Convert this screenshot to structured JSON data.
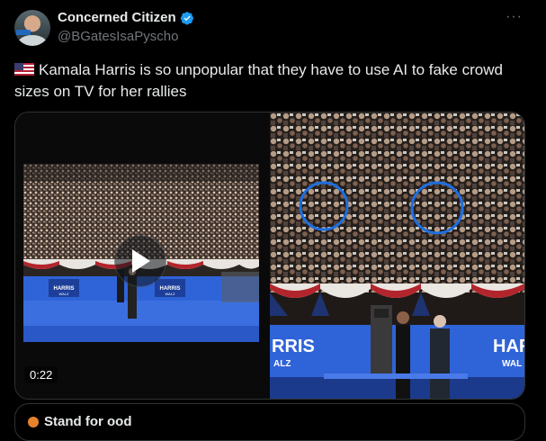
{
  "author": {
    "display_name": "Concerned Citizen",
    "handle": "@BGatesIsaPyscho",
    "verified": true
  },
  "more_icon": "more-horizontal-icon",
  "tweet": {
    "flag_icon": "us-flag-icon",
    "text": "Kamala Harris is so unpopular that they have to use AI to fake crowd sizes on TV for her rallies"
  },
  "media": {
    "duration": "0:22",
    "play_icon": "play-icon",
    "left_banner": "HARRIS",
    "left_banner_sub": "WALZ",
    "right_banner": "RRIS",
    "right_banner_sub": "ALZ",
    "right_banner_far": "HARR",
    "right_banner_far_sub": "WAL",
    "circle_color": "#1d6fe0"
  },
  "sub_card": {
    "label": "Stand for ood"
  },
  "colors": {
    "background": "#000000",
    "text": "#e7e9ea",
    "muted": "#71767b",
    "verified": "#1d9bf0",
    "border": "#2f3336"
  }
}
